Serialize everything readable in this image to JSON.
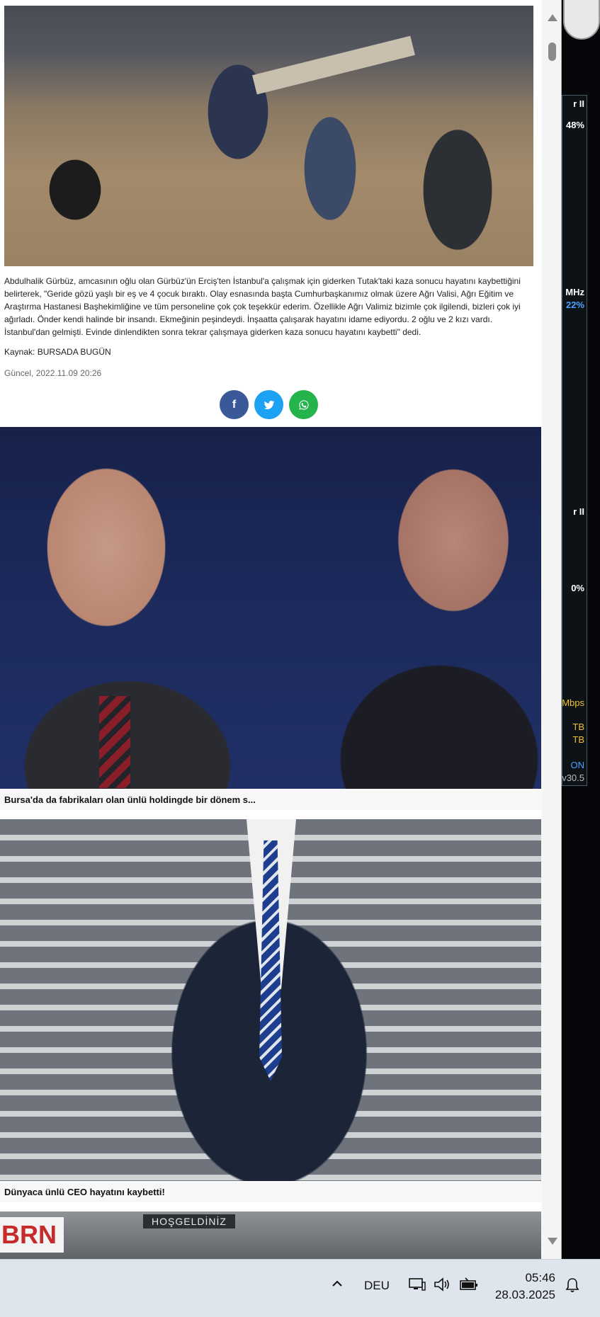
{
  "article": {
    "body": "Abdulhalik Gürbüz, amcasının oğlu olan Gürbüz'ün Erciş'ten İstanbul'a çalışmak için giderken Tutak'taki kaza sonucu hayatını kaybettiğini belirterek, \"Geride gözü yaşlı bir eş ve 4 çocuk bıraktı. Olay esnasında başta Cumhurbaşkanımız olmak üzere Ağrı Valisi, Ağrı Eğitim ve Araştırma Hastanesi Başhekimliğine ve tüm personeline çok çok teşekkür ederim. Özellikle Ağrı Valimiz bizimle çok ilgilendi, bizleri çok iyi ağırladı. Önder kendi halinde bir insandı. Ekmeğinin peşindeydi. İnşaatta çalışarak hayatını idame ediyordu. 2 oğlu ve 2 kızı vardı. İstanbul'dan gelmişti. Evinde dinlendikten sonra tekrar çalışmaya giderken kaza sonucu hayatını kaybetti\" dedi.",
    "source": "Kaynak: BURSADA BUGÜN",
    "updated": "Güncel, 2022.11.09 20:26"
  },
  "share": {
    "facebook_label": "f"
  },
  "related": [
    {
      "title": "Bursa'da da fabrikaları olan ünlü holdingde bir dönem s..."
    },
    {
      "title": "Dünyaca ünlü CEO hayatını kaybetti!"
    }
  ],
  "related_photo_text": {
    "brn": "BRN",
    "sign": "HOŞGELDİNİZ"
  },
  "side_gadget": {
    "top_label": "r II",
    "cpu_percent": "48%",
    "mhz": "MHz",
    "freq_percent": "22%",
    "net_label": "r II",
    "net_percent": "0%",
    "mbps": "Mbps",
    "tb1": "TB",
    "tb2": "TB",
    "on": "ON",
    "version": "v30.5"
  },
  "taskbar": {
    "language": "DEU",
    "time": "05:46",
    "date": "28.03.2025"
  },
  "colors": {
    "facebook": "#3b5998",
    "twitter": "#1da1f2",
    "whatsapp": "#25b34b"
  }
}
